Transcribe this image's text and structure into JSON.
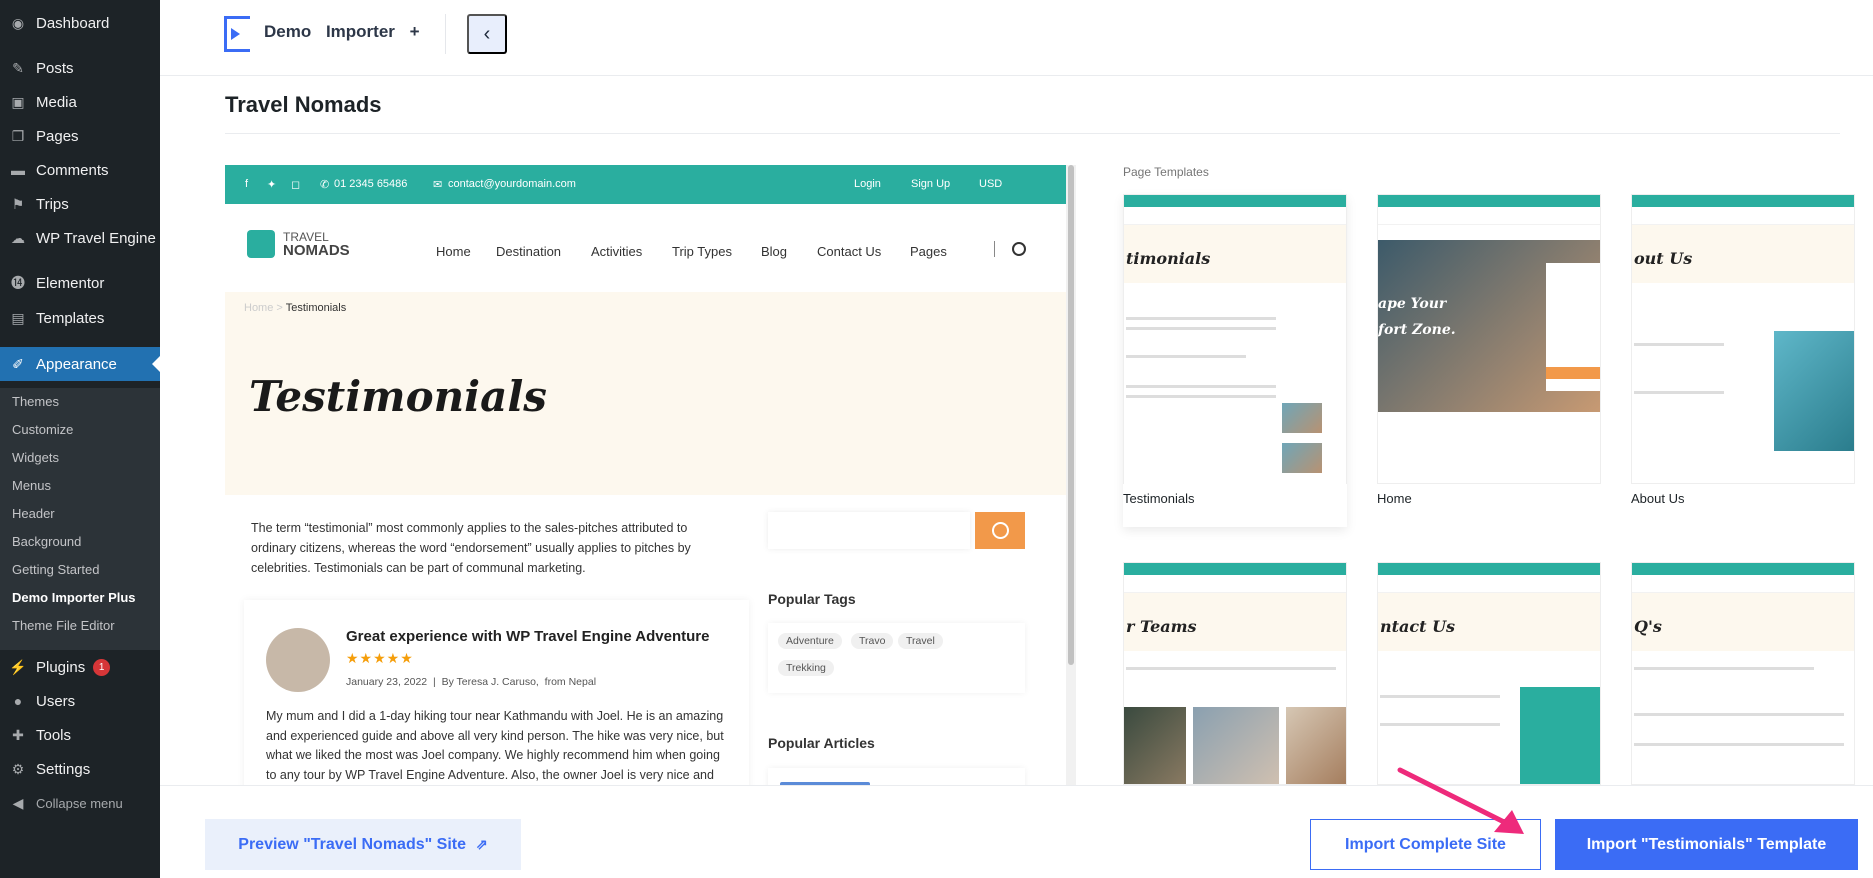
{
  "wp_menu": {
    "items": [
      {
        "label": "Dashboard",
        "icon": "dashboard-icon"
      },
      {
        "label": "Posts",
        "icon": "pin-icon"
      },
      {
        "label": "Media",
        "icon": "media-icon"
      },
      {
        "label": "Pages",
        "icon": "pages-icon"
      },
      {
        "label": "Comments",
        "icon": "comment-icon"
      },
      {
        "label": "Trips",
        "icon": "trips-icon"
      },
      {
        "label": "WP Travel Engine",
        "icon": "travel-icon"
      },
      {
        "label": "Elementor",
        "icon": "elementor-icon"
      },
      {
        "label": "Templates",
        "icon": "folder-icon"
      },
      {
        "label": "Appearance",
        "icon": "brush-icon"
      }
    ],
    "sub_items": [
      "Themes",
      "Customize",
      "Widgets",
      "Menus",
      "Header",
      "Background",
      "Getting Started",
      "Demo Importer Plus",
      "Theme File Editor"
    ],
    "bottom_items": [
      {
        "label": "Plugins",
        "icon": "plugin-icon",
        "badge": "1"
      },
      {
        "label": "Users",
        "icon": "users-icon"
      },
      {
        "label": "Tools",
        "icon": "tools-icon"
      },
      {
        "label": "Settings",
        "icon": "settings-icon"
      },
      {
        "label": "Collapse menu",
        "icon": "collapse-icon"
      }
    ],
    "active_color": "#2271b1"
  },
  "header": {
    "title": "Demo   Importer +",
    "back_icon": "chevron-left-icon"
  },
  "site_title": "Travel Nomads",
  "preview": {
    "topbar": {
      "phone": "01 2345 65486",
      "email": "contact@yourdomain.com",
      "login": "Login",
      "signup": "Sign Up",
      "currency": "USD"
    },
    "brand_top": "TRAVEL",
    "brand_bottom": "NOMADS",
    "nav": [
      "Home",
      "Destination",
      "Activities",
      "Trip Types",
      "Blog",
      "Contact Us",
      "Pages"
    ],
    "crumb_home": "Home",
    "crumb_sep": ">",
    "crumb_current": "Testimonials",
    "hero_title": "Testimonials",
    "intro": "The term “testimonial” most commonly applies to the sales-pitches attributed to ordinary citizens, whereas the word “endorsement” usually applies to pitches by celebrities. Testimonials can be part of communal marketing.",
    "card": {
      "title": "Great experience with WP Travel Engine Adventure",
      "stars": "★★★★★",
      "date": "January 23, 2022",
      "by": "By Teresa J. Caruso,",
      "from": "from Nepal",
      "text": "My mum and I did a 1-day hiking tour near Kathmandu with Joel. He is an amazing and experienced guide and above all very kind person. The hike was very nice, but what we liked the most was Joel company. We highly recommend him when going to any tour by WP Travel Engine Adventure. Also, the owner Joel is very nice and"
    },
    "popular_tags_label": "Popular Tags",
    "tags": [
      "Adventure",
      "Travo",
      "Travel",
      "Trekking"
    ],
    "popular_articles_label": "Popular Articles",
    "accent": "#2aae9f",
    "orange": "#f2994a"
  },
  "page_templates": {
    "label": "Page Templates",
    "items": [
      {
        "caption": "Testimonials",
        "hero": "timonials"
      },
      {
        "caption": "Home",
        "hero": "ape Your fort Zone."
      },
      {
        "caption": "About Us",
        "hero": "out Us"
      },
      {
        "caption": "",
        "hero": "r Teams"
      },
      {
        "caption": "",
        "hero": "ntact Us"
      },
      {
        "caption": "",
        "hero": "Q's"
      }
    ]
  },
  "footer": {
    "preview_label": "Preview \"Travel Nomads\" Site",
    "import_label": "Import Complete Site",
    "template_label": "Import \"Testimonials\" Template",
    "brand_color": "#3b6cf5"
  }
}
